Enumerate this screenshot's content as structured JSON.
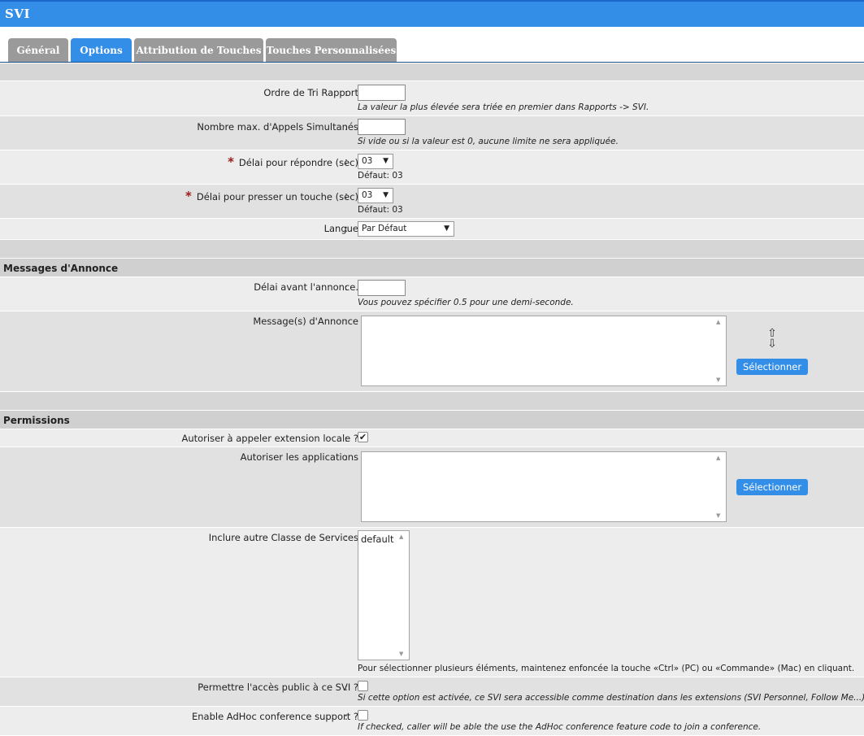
{
  "header": {
    "title": "SVI"
  },
  "tabs": [
    {
      "label": "Général",
      "active": false
    },
    {
      "label": "Options",
      "active": true
    },
    {
      "label": "Attribution de Touches",
      "active": false
    },
    {
      "label": "Touches Personnalisées",
      "active": false
    }
  ],
  "form": {
    "sort_order": {
      "label": "Ordre de Tri Rapport",
      "value": "",
      "help": "La valeur la plus élevée sera triée en premier dans Rapports -> SVI."
    },
    "max_calls": {
      "label": "Nombre max. d'Appels Simultanés",
      "value": "",
      "help": "Si vide ou si la valeur est 0, aucune limite ne sera appliquée."
    },
    "answer_delay": {
      "label": "Délai pour répondre (sec)",
      "value": "03",
      "default": "Défaut: 03",
      "required": "*"
    },
    "key_delay": {
      "label": "Délai pour presser un touche (sec)",
      "value": "03",
      "default": "Défaut: 03",
      "required": "*"
    },
    "language": {
      "label": "Langue",
      "value": "Par Défaut"
    }
  },
  "announcements": {
    "heading": "Messages d'Annonce",
    "delay": {
      "label": "Délai avant l'annonce.",
      "value": "",
      "help": "Vous pouvez spécifier 0.5 pour une demi-seconde."
    },
    "messages": {
      "label": "Message(s) d'Annonce",
      "button": "Sélectionner"
    }
  },
  "permissions": {
    "heading": "Permissions",
    "local_ext": {
      "label": "Autoriser à appeler extension locale ?",
      "checked": true
    },
    "apps": {
      "label": "Autoriser les applications",
      "button": "Sélectionner"
    },
    "cos": {
      "label": "Inclure autre Classe de Services",
      "options": [
        "default"
      ],
      "help": "Pour sélectionner plusieurs éléments, maintenez enfoncée la touche «Ctrl» (PC) ou «Commande» (Mac) en cliquant."
    },
    "public": {
      "label": "Permettre l'accès public à ce SVI ?",
      "checked": false,
      "help": "Si cette option est activée, ce SVI sera accessible comme destination dans les extensions (SVI Personnel, Follow Me...)."
    },
    "adhoc": {
      "label": "Enable AdHoc conference support ?",
      "checked": false,
      "help": "If checked, caller will be able the use the AdHoc conference feature code to join a conference."
    }
  },
  "glyphs": {
    "colon": ":",
    "arrow_down": "▼",
    "arrow_up": "▲",
    "check": "✔",
    "move_up": "⇧",
    "move_down": "⇩"
  },
  "colors": {
    "accent": "#338ee8",
    "tab_inactive": "#9a9a9a",
    "required": "#9b1a1a"
  }
}
